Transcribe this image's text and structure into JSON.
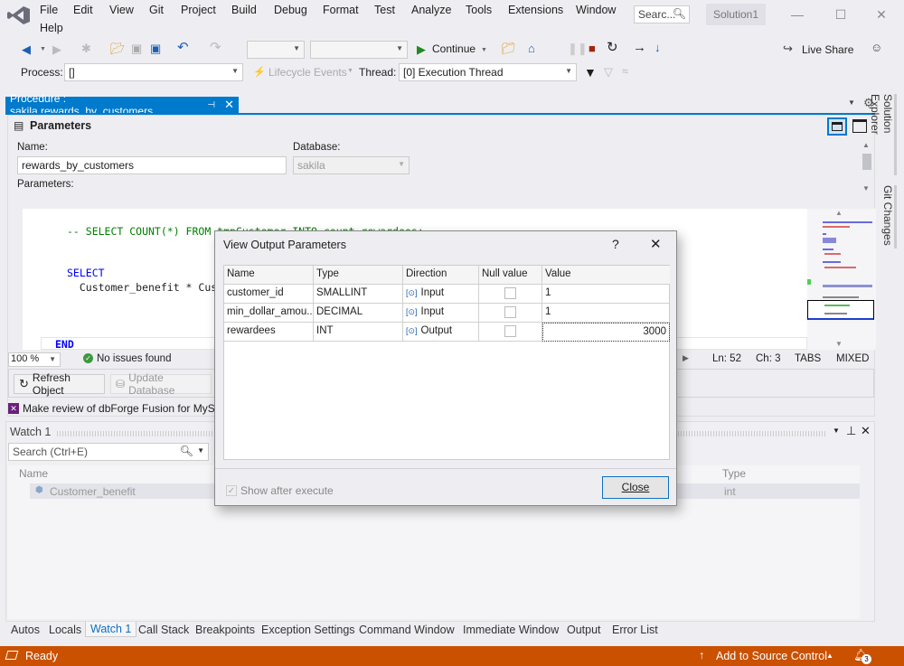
{
  "menu": {
    "items": [
      "File",
      "Edit",
      "View",
      "Git",
      "Project",
      "Build",
      "Debug",
      "Format",
      "Test",
      "Analyze",
      "Tools",
      "Extensions",
      "Window",
      "Help"
    ],
    "search_placeholder": "Searc...",
    "solution_name": "Solution1"
  },
  "toolbar": {
    "continue_label": "Continue",
    "live_share_label": "Live Share",
    "process_label": "Process:",
    "process_value": "[]",
    "lifecycle_label": "Lifecycle Events",
    "thread_label": "Thread:",
    "thread_value": "[0] Execution Thread"
  },
  "document_tab": {
    "title": "Procedure : sakila.rewards_by_customers"
  },
  "parameters_panel": {
    "heading": "Parameters",
    "name_label": "Name:",
    "name_value": "rewards_by_customers",
    "database_label": "Database:",
    "database_value": "sakila",
    "parameters_label": "Parameters:"
  },
  "editor": {
    "line1": "-- SELECT COUNT(*) FROM tmpCustomer INTO count_rewardees;",
    "line2": "SELECT",
    "line3": "  Customer_benefit * Cus",
    "line4": "END",
    "zoom": "100 %",
    "issues": "No issues found",
    "ln": "Ln: 52",
    "ch": "Ch: 3",
    "tabs": "TABS",
    "mixed": "MIXED"
  },
  "actions": {
    "refresh": "Refresh Object",
    "update": "Update Database",
    "review": "Make review of dbForge Fusion for MySQL"
  },
  "dialog": {
    "title": "View Output Parameters",
    "help": "?",
    "columns": [
      "Name",
      "Type",
      "Direction",
      "Null value",
      "Value"
    ],
    "rows": [
      {
        "name": "customer_id",
        "type": "SMALLINT",
        "direction": "Input",
        "null": false,
        "value": "1"
      },
      {
        "name": "min_dollar_amou...",
        "type": "DECIMAL",
        "direction": "Input",
        "null": false,
        "value": "1"
      },
      {
        "name": "rewardees",
        "type": "INT",
        "direction": "Output",
        "null": false,
        "value": "3000"
      }
    ],
    "show_after_execute": "Show after execute",
    "close": "Close"
  },
  "watch": {
    "title": "Watch 1",
    "search_placeholder": "Search (Ctrl+E)",
    "col_name": "Name",
    "col_type": "Type",
    "rows": [
      {
        "name": "Customer_benefit",
        "type": "int"
      }
    ]
  },
  "bottom_tabs": [
    "Autos",
    "Locals",
    "Watch 1",
    "Call Stack",
    "Breakpoints",
    "Exception Settings",
    "Command Window",
    "Immediate Window",
    "Output",
    "Error List"
  ],
  "side_tabs": [
    "Solution Explorer",
    "Git Changes"
  ],
  "status": {
    "ready": "Ready",
    "source_control": "Add to Source Control",
    "notifications": "3"
  }
}
